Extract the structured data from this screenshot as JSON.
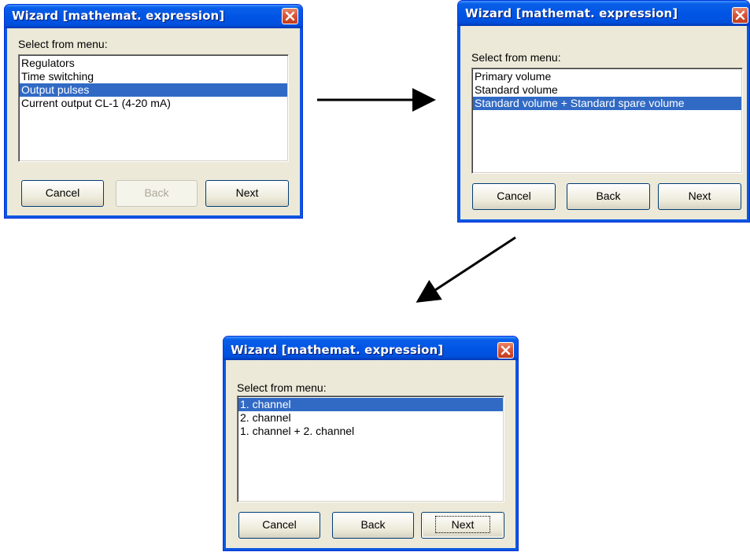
{
  "dialogs": [
    {
      "title": "Wizard [mathemat. expression]",
      "label": "Select from menu:",
      "items": [
        "Regulators",
        "Time switching",
        "Output pulses",
        "Current output CL-1 (4-20 mA)"
      ],
      "selected_index": 2,
      "buttons": {
        "cancel": "Cancel",
        "back": "Back",
        "next": "Next"
      },
      "back_enabled": false
    },
    {
      "title": "Wizard [mathemat. expression]",
      "label": "Select from menu:",
      "items": [
        "Primary volume",
        "Standard volume",
        "Standard volume + Standard spare volume"
      ],
      "selected_index": 2,
      "buttons": {
        "cancel": "Cancel",
        "back": "Back",
        "next": "Next"
      },
      "back_enabled": true
    },
    {
      "title": "Wizard [mathemat. expression]",
      "label": "Select from menu:",
      "items": [
        "1. channel",
        "2. channel",
        "1. channel + 2. channel"
      ],
      "selected_index": 0,
      "buttons": {
        "cancel": "Cancel",
        "back": "Back",
        "next": "Next"
      },
      "back_enabled": true,
      "next_focused": true
    }
  ],
  "colors": {
    "title_bar": "#0055e5",
    "selection": "#316ac5",
    "dialog_face": "#ece9d8",
    "close_button": "#d8563a"
  }
}
